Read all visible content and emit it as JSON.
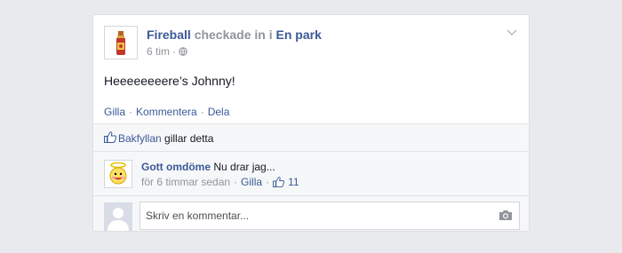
{
  "post": {
    "author": "Fireball",
    "action": "checkade in i",
    "place": "En park",
    "time": "6 tim",
    "text": "Heeeeeeeere’s Johnny!"
  },
  "actions": {
    "like": "Gilla",
    "comment": "Kommentera",
    "share": "Dela"
  },
  "likes": {
    "name": "Bakfyllan",
    "suffix": "gillar detta"
  },
  "comment": {
    "author": "Gott omdöme",
    "text": "Nu drar jag...",
    "time": "för 6 timmar sedan",
    "like": "Gilla",
    "like_count": "11"
  },
  "composer": {
    "placeholder": "Skriv en kommentar..."
  },
  "colors": {
    "link": "#3b5998",
    "muted": "#90949c",
    "background": "#e9eaed"
  }
}
